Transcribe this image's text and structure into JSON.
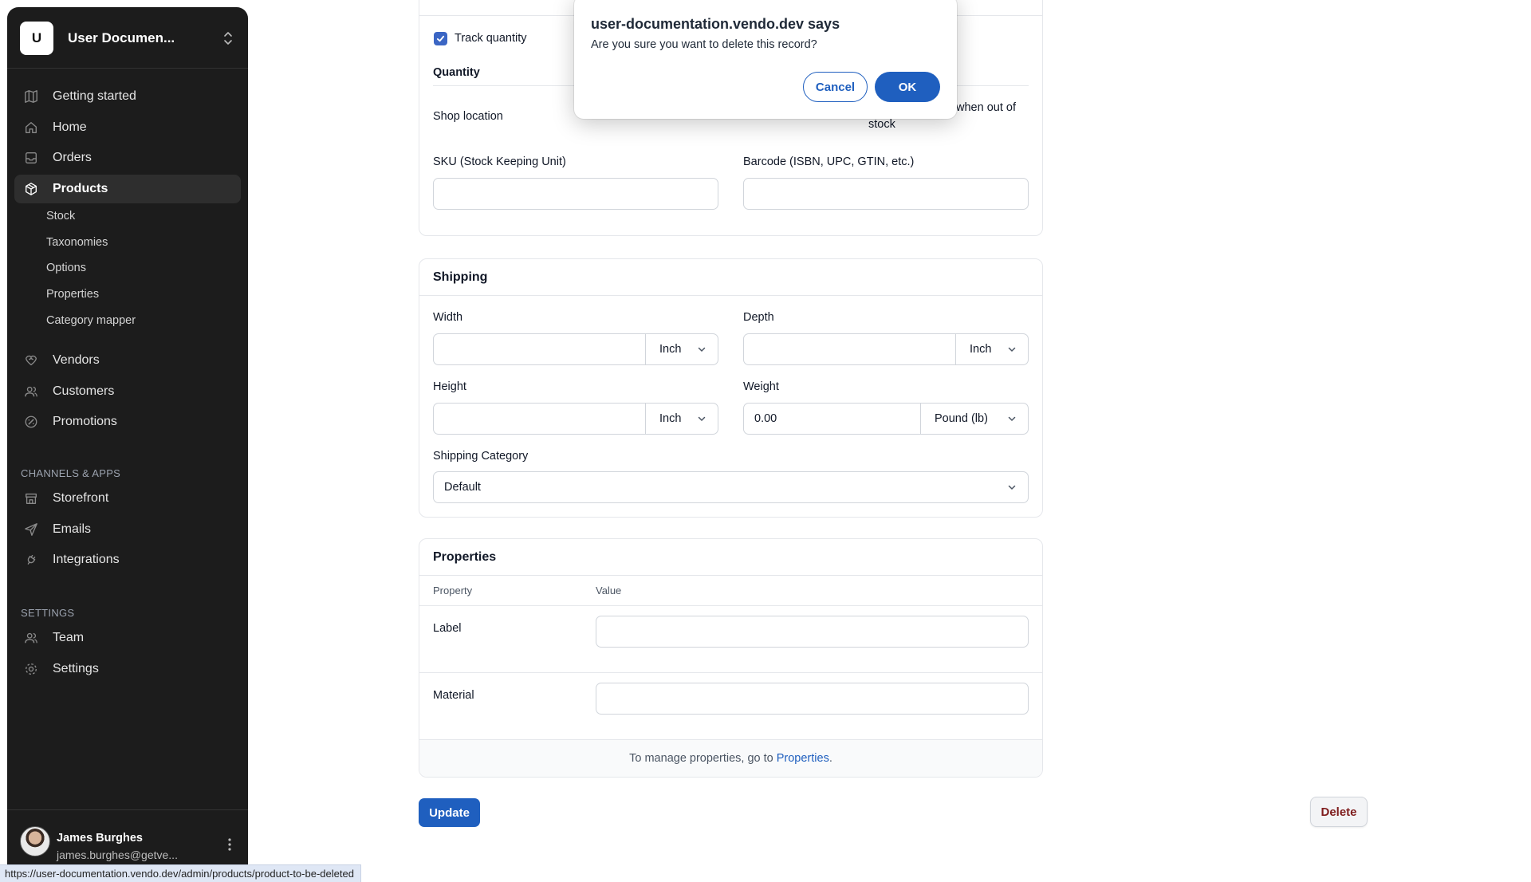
{
  "sidebar": {
    "store_initial": "U",
    "store_name": "User Documen...",
    "nav_main": [
      {
        "label": "Getting started",
        "icon": "map-icon"
      },
      {
        "label": "Home",
        "icon": "home-icon"
      },
      {
        "label": "Orders",
        "icon": "inbox-icon"
      },
      {
        "label": "Products",
        "icon": "box-icon"
      }
    ],
    "products_sub": [
      "Stock",
      "Taxonomies",
      "Options",
      "Properties",
      "Category mapper"
    ],
    "nav_more": [
      {
        "label": "Vendors",
        "icon": "handshake-icon"
      },
      {
        "label": "Customers",
        "icon": "users-icon"
      },
      {
        "label": "Promotions",
        "icon": "discount-icon"
      }
    ],
    "channels_label": "CHANNELS & APPS",
    "channels": [
      {
        "label": "Storefront",
        "icon": "storefront-icon"
      },
      {
        "label": "Emails",
        "icon": "send-icon"
      },
      {
        "label": "Integrations",
        "icon": "plug-icon"
      }
    ],
    "settings_label": "SETTINGS",
    "settings": [
      {
        "label": "Team",
        "icon": "team-icon"
      },
      {
        "label": "Settings",
        "icon": "gear-icon"
      }
    ],
    "user": {
      "name": "James Burghes",
      "email": "james.burghes@getve..."
    }
  },
  "status_url": "https://user-documentation.vendo.dev/admin/products/product-to-be-deleted",
  "inventory": {
    "track_quantity_label": "Track quantity",
    "quantity_label": "Quantity",
    "shop_location_label": "Shop location",
    "backorder_text_1": "when out of",
    "backorder_text_2": "stock",
    "sku_label": "SKU (Stock Keeping Unit)",
    "barcode_label": "Barcode (ISBN, UPC, GTIN, etc.)"
  },
  "shipping": {
    "title": "Shipping",
    "width_label": "Width",
    "width_unit": "Inch",
    "depth_label": "Depth",
    "depth_unit": "Inch",
    "height_label": "Height",
    "height_unit": "Inch",
    "weight_label": "Weight",
    "weight_value": "0.00",
    "weight_unit": "Pound (lb)",
    "category_label": "Shipping Category",
    "category_value": "Default"
  },
  "properties": {
    "title": "Properties",
    "col_property": "Property",
    "col_value": "Value",
    "rows": [
      {
        "name": "Label"
      },
      {
        "name": "Material"
      }
    ],
    "footer_text": "To manage properties, go to ",
    "footer_link": "Properties",
    "footer_end": "."
  },
  "actions": {
    "update": "Update",
    "delete": "Delete"
  },
  "dialog": {
    "title": "user-documentation.vendo.dev says",
    "message": "Are you sure you want to delete this record?",
    "cancel": "Cancel",
    "ok": "OK"
  },
  "colors": {
    "primary": "#1f5fbf",
    "sidebar_bg": "#1c1c1c",
    "danger_text": "#7f1d1d"
  }
}
